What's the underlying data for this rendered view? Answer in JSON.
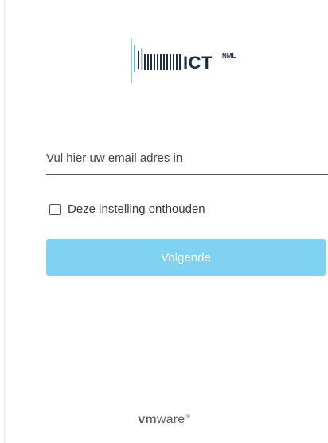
{
  "logo": {
    "name": "ICT",
    "superscript": "NML"
  },
  "login": {
    "email_placeholder": "Vul hier uw email adres in",
    "remember_label": "Deze instelling onthouden",
    "next_label": "Volgende"
  },
  "footer": {
    "brand_vm": "vm",
    "brand_ware": "ware",
    "brand_mark": "®"
  },
  "colors": {
    "button": "#80d2f2",
    "logo_text": "#1a2c4a",
    "logo_bars": "#5fb7e2"
  }
}
